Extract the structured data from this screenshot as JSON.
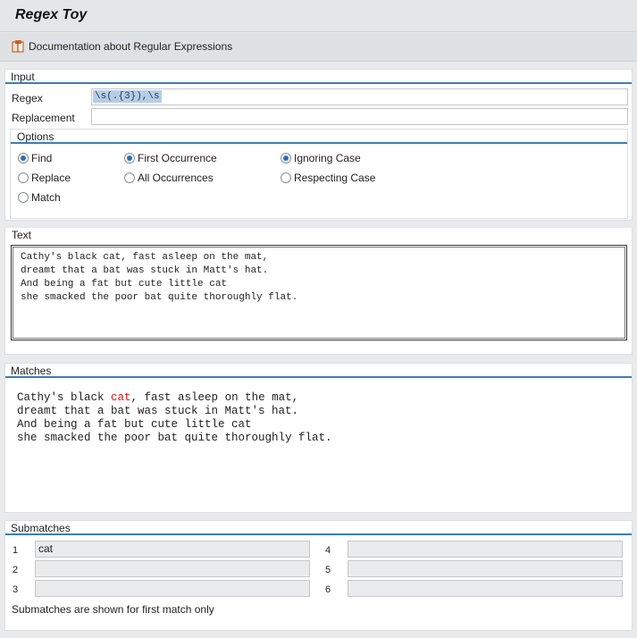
{
  "window": {
    "title": "Regex Toy"
  },
  "toolbar": {
    "doc_link": "Documentation about Regular Expressions",
    "doc_icon": "book-icon"
  },
  "input": {
    "section_title": "Input",
    "regex_label": "Regex",
    "regex_value": "\\s(.{3}),\\s",
    "replacement_label": "Replacement",
    "replacement_value": ""
  },
  "options": {
    "section_title": "Options",
    "mode": [
      {
        "label": "Find",
        "selected": true
      },
      {
        "label": "Replace",
        "selected": false
      },
      {
        "label": "Match",
        "selected": false
      }
    ],
    "occurrence": [
      {
        "label": "First Occurrence",
        "selected": true
      },
      {
        "label": "All Occurrences",
        "selected": false
      }
    ],
    "case": [
      {
        "label": "Ignoring Case",
        "selected": true
      },
      {
        "label": "Respecting Case",
        "selected": false
      }
    ]
  },
  "text": {
    "section_title": "Text",
    "lines": [
      "Cathy's black cat, fast asleep on the mat,",
      "dreamt that a bat was stuck in Matt's hat.",
      "And being a fat but cute little cat",
      "she smacked the poor bat quite thoroughly flat."
    ]
  },
  "matches": {
    "section_title": "Matches",
    "line1_before": "Cathy's black ",
    "line1_match": "cat",
    "line1_after": ", fast asleep on the mat,",
    "lines": [
      "dreamt that a bat was stuck in Matt's hat.",
      "And being a fat but cute little cat",
      "she smacked the poor bat quite thoroughly flat."
    ],
    "highlight_color": "#e01010"
  },
  "submatches": {
    "section_title": "Submatches",
    "items": [
      {
        "num": "1",
        "value": "cat"
      },
      {
        "num": "2",
        "value": ""
      },
      {
        "num": "3",
        "value": ""
      },
      {
        "num": "4",
        "value": ""
      },
      {
        "num": "5",
        "value": ""
      },
      {
        "num": "6",
        "value": ""
      }
    ],
    "note": "Submatches are shown for first match only"
  },
  "colors": {
    "accent": "#3a7fb8",
    "selection": "#b7cde3"
  }
}
